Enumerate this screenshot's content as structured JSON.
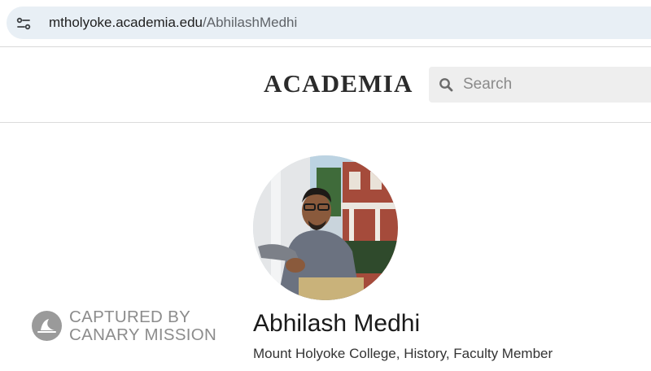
{
  "browser": {
    "url_host": "mtholyoke.academia.edu",
    "url_path": "/AbhilashMedhi",
    "site_info_icon": "tune-icon"
  },
  "header": {
    "logo": "ACADEMIA",
    "search": {
      "placeholder": "Search",
      "icon": "search-icon"
    }
  },
  "profile": {
    "name": "Abhilash Medhi",
    "affiliation": "Mount Holyoke College, History, Faculty Member"
  },
  "watermark": {
    "line1": "CAPTURED BY",
    "line2": "CANARY MISSION",
    "icon": "canary-mission-logo"
  },
  "colors": {
    "url_bar": "#e8eff5",
    "search_box": "#eeeeee",
    "logo": "#2b2b2b",
    "watermark": "#8c8c8c"
  }
}
